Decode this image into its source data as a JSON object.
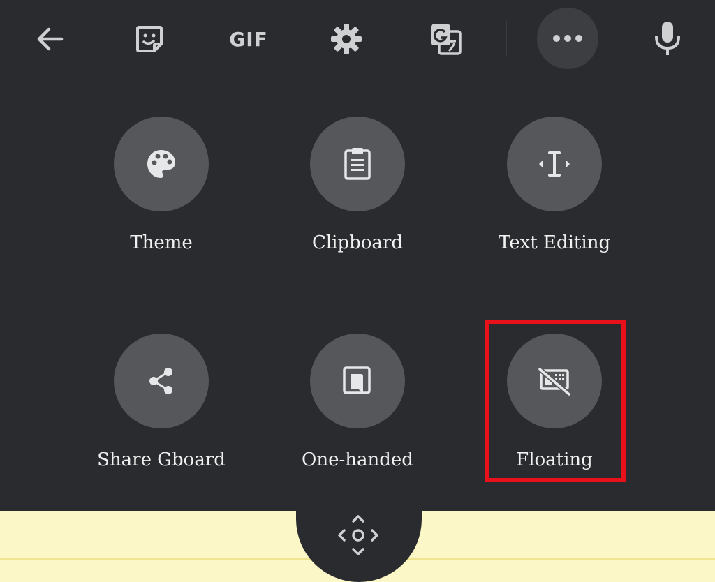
{
  "toolbar": {
    "back_icon": "arrow-left-icon",
    "sticker_icon": "sticker-icon",
    "gif_label": "GIF",
    "settings_icon": "gear-icon",
    "translate_icon": "translate-icon",
    "more_icon": "more-horizontal-icon",
    "mic_icon": "microphone-icon"
  },
  "menu": {
    "items": [
      {
        "label": "Theme",
        "icon": "palette-icon"
      },
      {
        "label": "Clipboard",
        "icon": "clipboard-icon"
      },
      {
        "label": "Text Editing",
        "icon": "text-cursor-icon"
      },
      {
        "label": "Share Gboard",
        "icon": "share-icon"
      },
      {
        "label": "One-handed",
        "icon": "one-handed-icon"
      },
      {
        "label": "Floating",
        "icon": "floating-keyboard-icon"
      }
    ],
    "highlighted": "Floating"
  },
  "colors": {
    "background": "#292b2f",
    "circle": "#55575b",
    "highlight": "#e8101a",
    "paper": "#fbf7c6"
  }
}
